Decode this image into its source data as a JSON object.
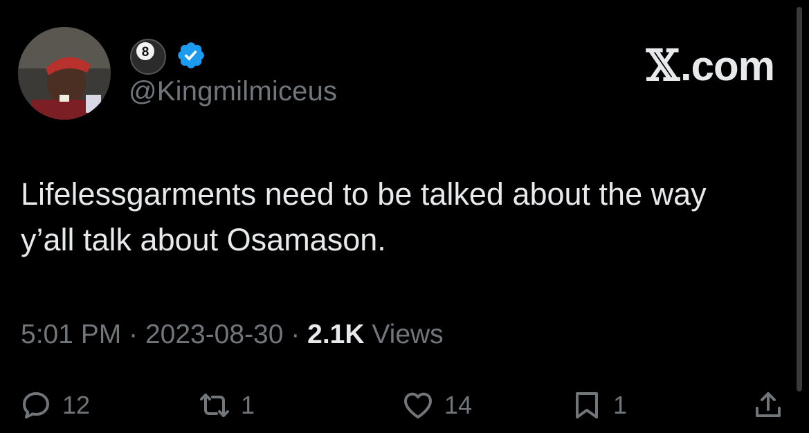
{
  "brand": {
    "prefix": "𝕏",
    "label": ".com"
  },
  "author": {
    "display_icon": "eight-ball-icon",
    "display_badge": "8",
    "verified_icon": "verified-badge-icon",
    "handle": "@Kingmilmiceus"
  },
  "tweet": {
    "text": "Lifelessgarments need to be talked about the way y’all talk about Osamason.",
    "time": "5:01 PM",
    "date": "2023-08-30",
    "views_count": "2.1K",
    "views_label": "Views",
    "separator": "·"
  },
  "actions": {
    "replies": "12",
    "reposts": "1",
    "likes": "14",
    "bookmarks": "1"
  },
  "colors": {
    "background": "#000000",
    "text": "#e7e9ea",
    "muted": "#71767b",
    "verified": "#1d9bf0"
  }
}
